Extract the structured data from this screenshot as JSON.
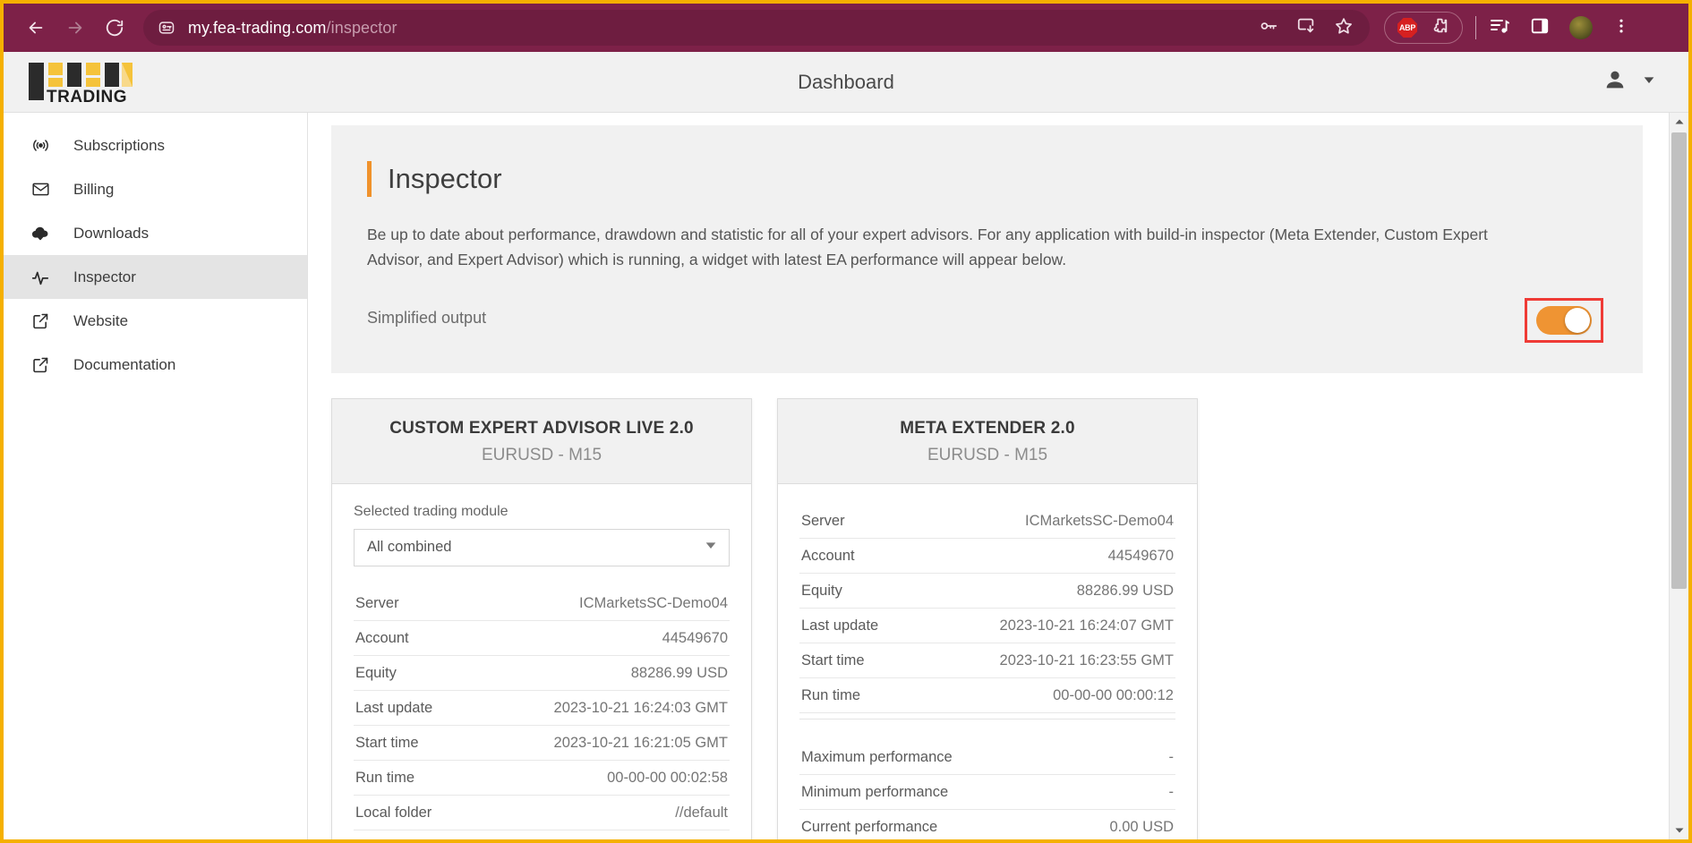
{
  "browser": {
    "back_icon": "back-arrow-icon",
    "forward_icon": "forward-arrow-icon",
    "reload_icon": "reload-icon",
    "site_info_icon": "site-settings-icon",
    "url_host": "my.fea-trading.com",
    "url_path": "/inspector",
    "password_icon": "key-icon",
    "install_icon": "install-app-icon",
    "bookmark_icon": "star-icon",
    "adblock_label": "ABP",
    "extensions_icon": "extensions-puzzle-icon",
    "media_icon": "media-controls-icon",
    "sidepanel_icon": "side-panel-icon",
    "profile_icon": "profile-avatar-icon",
    "menu_icon": "three-dot-menu-icon"
  },
  "header": {
    "logo_text": "TRADING",
    "title": "Dashboard",
    "account_icon": "person-icon",
    "account_caret": "chevron-down-icon"
  },
  "sidebar": {
    "items": [
      {
        "label": "Subscriptions",
        "icon": "broadcast-icon",
        "active": false
      },
      {
        "label": "Billing",
        "icon": "envelope-icon",
        "active": false
      },
      {
        "label": "Downloads",
        "icon": "cloud-download-icon",
        "active": false
      },
      {
        "label": "Inspector",
        "icon": "activity-pulse-icon",
        "active": true
      },
      {
        "label": "Website",
        "icon": "external-link-icon",
        "active": false
      },
      {
        "label": "Documentation",
        "icon": "external-link-icon",
        "active": false
      }
    ]
  },
  "intro": {
    "title": "Inspector",
    "description": "Be up to date about performance, drawdown and statistic for all of your expert advisors. For any application with build-in inspector (Meta Extender, Custom Expert Advisor, and Expert Advisor) which is running, a widget with latest EA performance will appear below.",
    "simplified_label": "Simplified output",
    "toggle_state": "on",
    "toggle_color": "#ef9433",
    "highlight_color": "#ef3b36",
    "accent_color": "#f0922b"
  },
  "cards": [
    {
      "title": "CUSTOM EXPERT ADVISOR LIVE 2.0",
      "subtitle": "EURUSD - M15",
      "module_label": "Selected trading module",
      "module_value": "All combined",
      "rows": [
        {
          "key": "Server",
          "value": "ICMarketsSC-Demo04"
        },
        {
          "key": "Account",
          "value": "44549670"
        },
        {
          "key": "Equity",
          "value": "88286.99 USD"
        },
        {
          "key": "Last update",
          "value": "2023-10-21 16:24:03 GMT"
        },
        {
          "key": "Start time",
          "value": "2023-10-21 16:21:05 GMT"
        },
        {
          "key": "Run time",
          "value": "00-00-00 00:02:58"
        },
        {
          "key": "Local folder",
          "value": "//default"
        }
      ]
    },
    {
      "title": "META EXTENDER 2.0",
      "subtitle": "EURUSD - M15",
      "rows": [
        {
          "key": "Server",
          "value": "ICMarketsSC-Demo04"
        },
        {
          "key": "Account",
          "value": "44549670"
        },
        {
          "key": "Equity",
          "value": "88286.99 USD"
        },
        {
          "key": "Last update",
          "value": "2023-10-21 16:24:07 GMT"
        },
        {
          "key": "Start time",
          "value": "2023-10-21 16:23:55 GMT"
        },
        {
          "key": "Run time",
          "value": "00-00-00 00:00:12"
        }
      ],
      "performance": [
        {
          "key": "Maximum performance",
          "value": "-"
        },
        {
          "key": "Minimum performance",
          "value": "-"
        },
        {
          "key": "Current performance",
          "value": "0.00 USD"
        }
      ]
    }
  ]
}
